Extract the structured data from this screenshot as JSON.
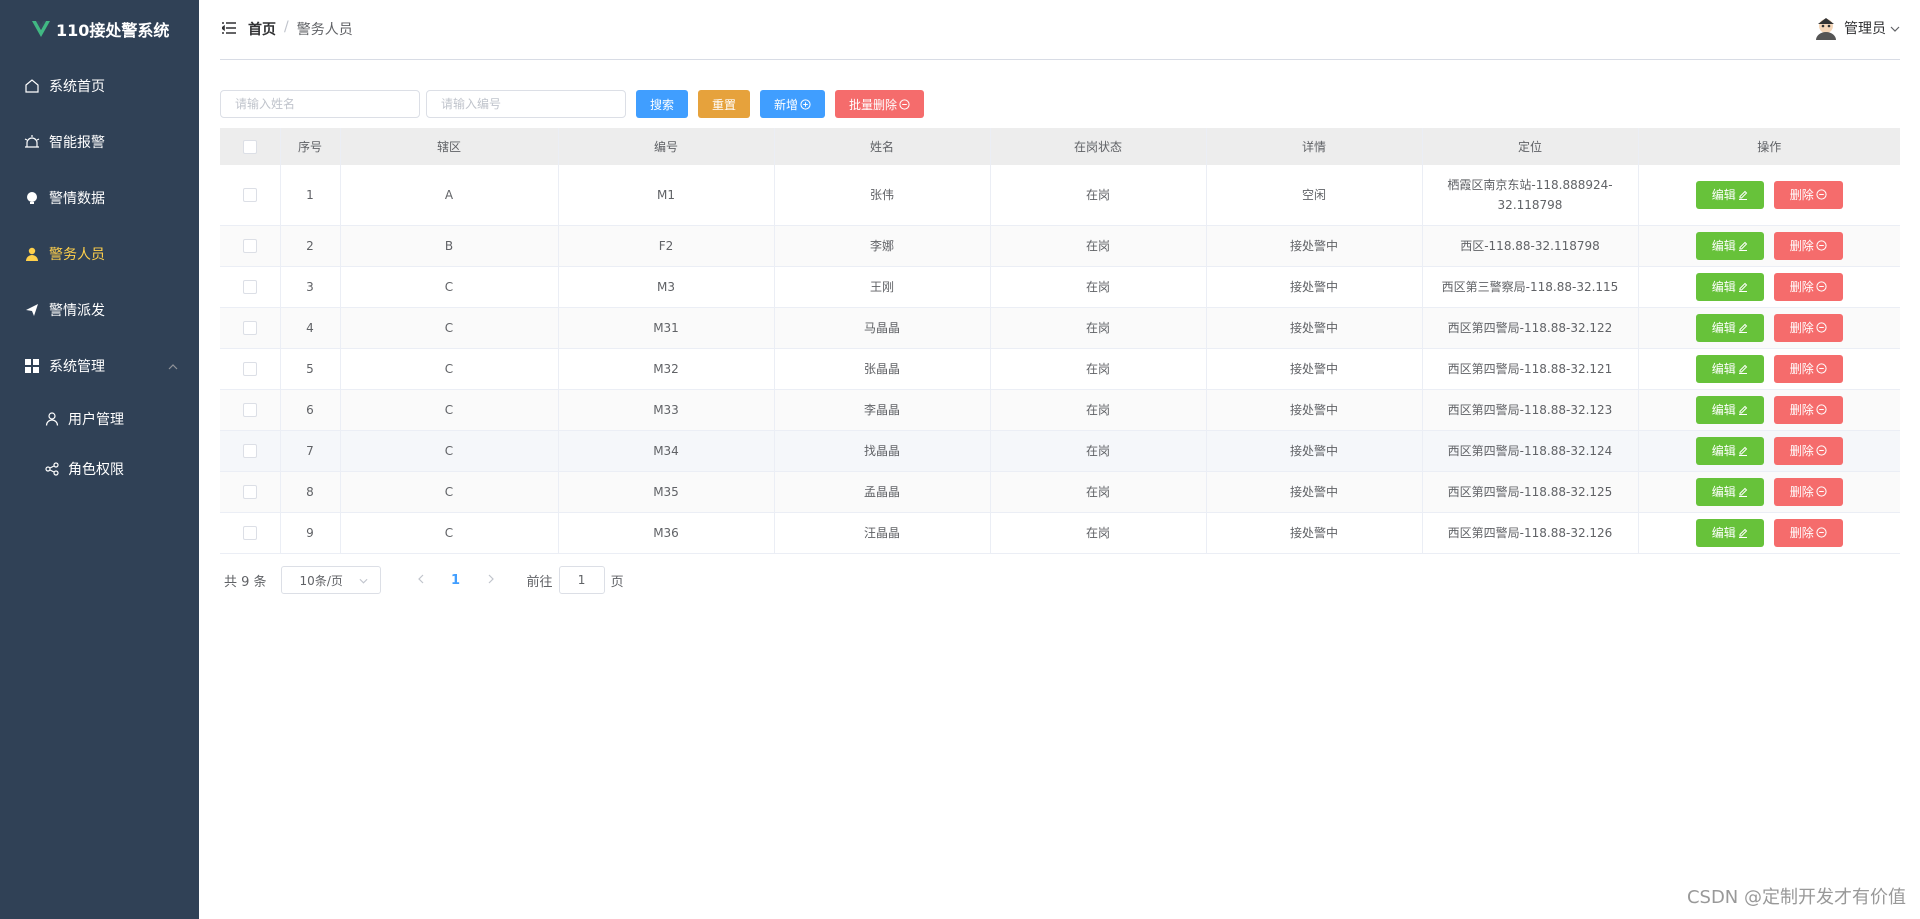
{
  "app": {
    "title": "110接处警系统"
  },
  "sidebar": {
    "items": [
      {
        "label": "系统首页",
        "icon": "home-icon"
      },
      {
        "label": "智能报警",
        "icon": "alarm-icon"
      },
      {
        "label": "警情数据",
        "icon": "data-icon"
      },
      {
        "label": "警务人员",
        "icon": "user-icon",
        "active": true
      },
      {
        "label": "警情派发",
        "icon": "send-icon"
      },
      {
        "label": "系统管理",
        "icon": "grid-icon",
        "expanded": true
      }
    ],
    "subitems": [
      {
        "label": "用户管理",
        "icon": "user-outline-icon"
      },
      {
        "label": "角色权限",
        "icon": "share-icon"
      }
    ],
    "active_color": "#ffd04b",
    "bg_color": "#304156"
  },
  "header": {
    "breadcrumb": {
      "home": "首页",
      "sep": "/",
      "current": "警务人员"
    },
    "user": "管理员"
  },
  "toolbar": {
    "name_placeholder": "请输入姓名",
    "code_placeholder": "请输入编号",
    "search_label": "搜索",
    "reset_label": "重置",
    "add_label": "新增",
    "batch_delete_label": "批量删除"
  },
  "table": {
    "columns": [
      "序号",
      "辖区",
      "编号",
      "姓名",
      "在岗状态",
      "详情",
      "定位",
      "操作"
    ],
    "edit_label": "编辑",
    "delete_label": "删除",
    "rows": [
      {
        "no": "1",
        "area": "A",
        "code": "M1",
        "name": "张伟",
        "status": "在岗",
        "detail": "空闲",
        "location": "栖霞区南京东站-118.888924-32.118798"
      },
      {
        "no": "2",
        "area": "B",
        "code": "F2",
        "name": "李娜",
        "status": "在岗",
        "detail": "接处警中",
        "location": "西区-118.88-32.118798"
      },
      {
        "no": "3",
        "area": "C",
        "code": "M3",
        "name": "王刚",
        "status": "在岗",
        "detail": "接处警中",
        "location": "西区第三警察局-118.88-32.115"
      },
      {
        "no": "4",
        "area": "C",
        "code": "M31",
        "name": "马晶晶",
        "status": "在岗",
        "detail": "接处警中",
        "location": "西区第四警局-118.88-32.122"
      },
      {
        "no": "5",
        "area": "C",
        "code": "M32",
        "name": "张晶晶",
        "status": "在岗",
        "detail": "接处警中",
        "location": "西区第四警局-118.88-32.121"
      },
      {
        "no": "6",
        "area": "C",
        "code": "M33",
        "name": "李晶晶",
        "status": "在岗",
        "detail": "接处警中",
        "location": "西区第四警局-118.88-32.123"
      },
      {
        "no": "7",
        "area": "C",
        "code": "M34",
        "name": "找晶晶",
        "status": "在岗",
        "detail": "接处警中",
        "location": "西区第四警局-118.88-32.124"
      },
      {
        "no": "8",
        "area": "C",
        "code": "M35",
        "name": "孟晶晶",
        "status": "在岗",
        "detail": "接处警中",
        "location": "西区第四警局-118.88-32.125"
      },
      {
        "no": "9",
        "area": "C",
        "code": "M36",
        "name": "汪晶晶",
        "status": "在岗",
        "detail": "接处警中",
        "location": "西区第四警局-118.88-32.126"
      }
    ]
  },
  "pagination": {
    "total": "共 9 条",
    "page_size": "10条/页",
    "current_page": "1",
    "goto_prefix": "前往",
    "goto_value": "1",
    "goto_suffix": "页"
  },
  "watermark": "CSDN @定制开发才有价值",
  "colors": {
    "primary": "#409eff",
    "warning": "#e6a23c",
    "danger": "#f56c6c",
    "success": "#67c23a"
  }
}
